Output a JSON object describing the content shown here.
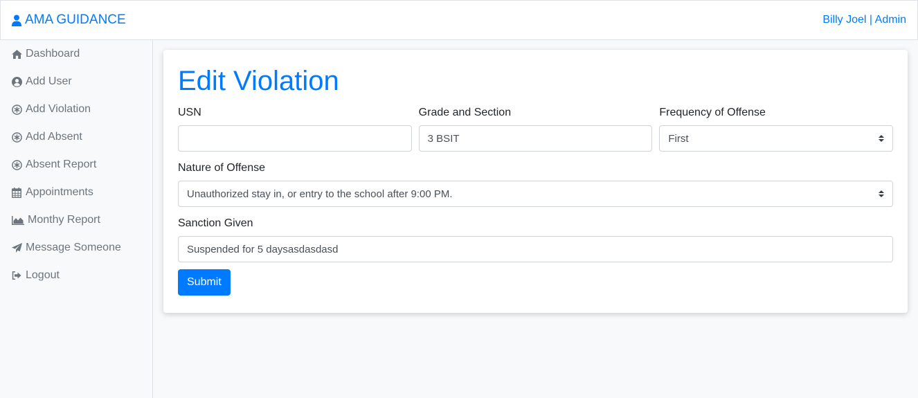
{
  "navbar": {
    "brand": "AMA GUIDANCE",
    "brand_icon": "user-icon",
    "user_name": "Billy Joel",
    "separator": " | ",
    "role": "Admin",
    "accent": "#007bff"
  },
  "sidebar": {
    "items": [
      {
        "label": "Dashboard",
        "icon": "home-icon"
      },
      {
        "label": "Add User",
        "icon": "user-circle-icon"
      },
      {
        "label": "Add Violation",
        "icon": "asterisk-circle-icon"
      },
      {
        "label": "Add Absent",
        "icon": "asterisk-circle-icon"
      },
      {
        "label": "Absent Report",
        "icon": "asterisk-circle-icon"
      },
      {
        "label": "Appointments",
        "icon": "calendar-icon"
      },
      {
        "label": "Monthy Report",
        "icon": "area-chart-icon"
      },
      {
        "label": "Message Someone",
        "icon": "paper-plane-icon"
      },
      {
        "label": "Logout",
        "icon": "sign-out-icon"
      }
    ]
  },
  "form": {
    "title": "Edit Violation",
    "usn": {
      "label": "USN",
      "value": ""
    },
    "grade_section": {
      "label": "Grade and Section",
      "value": "3 BSIT"
    },
    "frequency": {
      "label": "Frequency of Offense",
      "value": "First"
    },
    "nature": {
      "label": "Nature of Offense",
      "value": "Unauthorized stay in, or entry to the school after 9:00 PM."
    },
    "sanction": {
      "label": "Sanction Given",
      "value": "Suspended for 5 daysasdasdasd"
    },
    "submit_label": "Submit"
  }
}
